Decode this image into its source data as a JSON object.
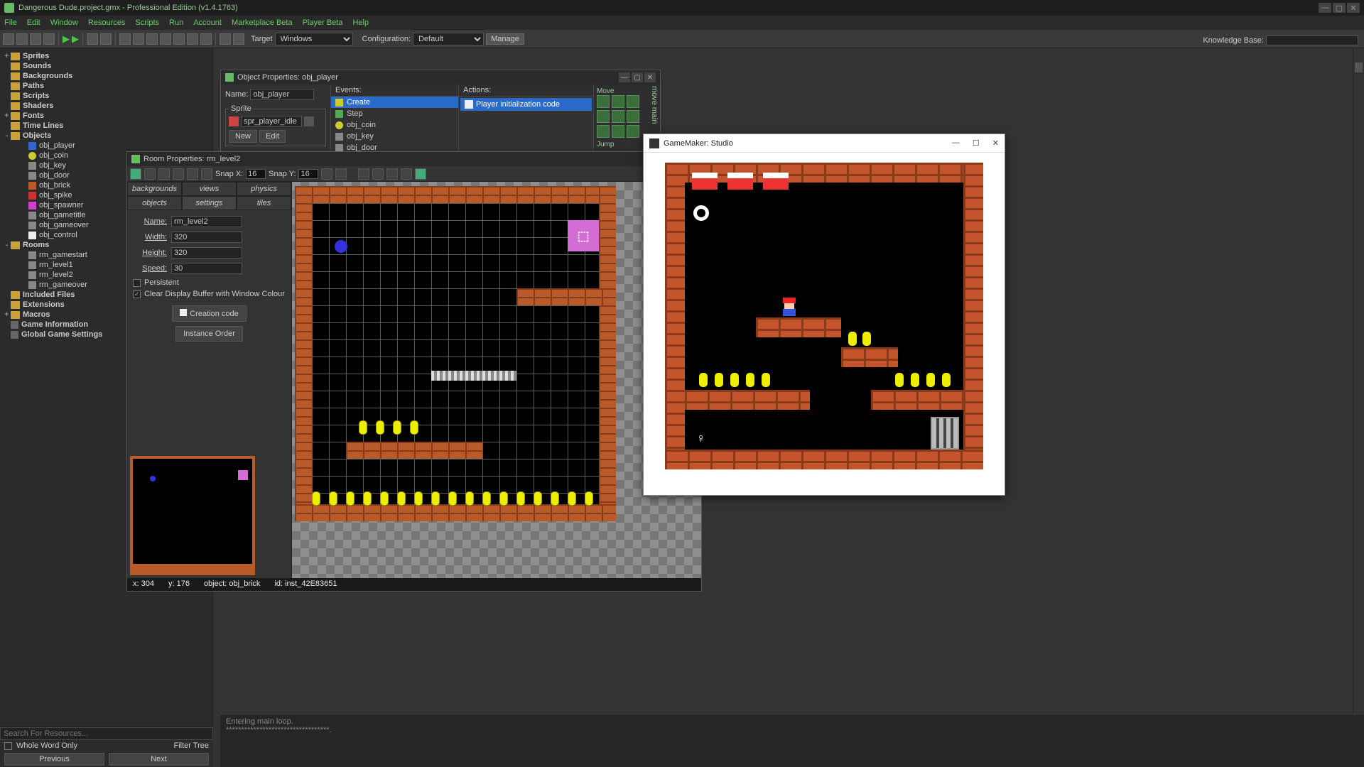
{
  "title": "Dangerous Dude.project.gmx  -  Professional Edition (v1.4.1763)",
  "menu": [
    "File",
    "Edit",
    "Window",
    "Resources",
    "Scripts",
    "Run",
    "Account",
    "Marketplace Beta",
    "Player Beta",
    "Help"
  ],
  "toolbar": {
    "target_label": "Target",
    "target_value": "Windows",
    "config_label": "Configuration:",
    "config_value": "Default",
    "manage": "Manage",
    "kb_label": "Knowledge Base:"
  },
  "tree": {
    "groups": [
      {
        "label": "Sprites",
        "exp": "+"
      },
      {
        "label": "Sounds"
      },
      {
        "label": "Backgrounds"
      },
      {
        "label": "Paths"
      },
      {
        "label": "Scripts"
      },
      {
        "label": "Shaders"
      },
      {
        "label": "Fonts",
        "exp": "+"
      },
      {
        "label": "Time Lines"
      },
      {
        "label": "Objects",
        "exp": "-",
        "children": [
          {
            "label": "obj_player",
            "cls": "icon-blue"
          },
          {
            "label": "obj_coin",
            "cls": "icon-yellow"
          },
          {
            "label": "obj_key",
            "cls": "icon-grey"
          },
          {
            "label": "obj_door",
            "cls": "icon-grey"
          },
          {
            "label": "obj_brick",
            "cls": "icon-orange"
          },
          {
            "label": "obj_spike",
            "cls": "icon-red"
          },
          {
            "label": "obj_spawner",
            "cls": "icon-pink"
          },
          {
            "label": "obj_gametitle",
            "cls": "icon-grey"
          },
          {
            "label": "obj_gameover",
            "cls": "icon-grey"
          },
          {
            "label": "obj_control",
            "cls": "icon-white"
          }
        ]
      },
      {
        "label": "Rooms",
        "exp": "-",
        "children": [
          {
            "label": "rm_gamestart",
            "cls": "icon-grey"
          },
          {
            "label": "rm_level1",
            "cls": "icon-grey"
          },
          {
            "label": "rm_level2",
            "cls": "icon-grey"
          },
          {
            "label": "rm_gameover",
            "cls": "icon-grey"
          }
        ]
      },
      {
        "label": "Included Files"
      },
      {
        "label": "Extensions"
      },
      {
        "label": "Macros",
        "exp": "+"
      },
      {
        "label": "Game Information",
        "leaf": true
      },
      {
        "label": "Global Game Settings",
        "leaf": true
      }
    ],
    "search_placeholder": "Search For Resources...",
    "whole_word": "Whole Word Only",
    "filter_tree": "Filter Tree",
    "prev": "Previous",
    "next": "Next"
  },
  "obj_win": {
    "title": "Object Properties: obj_player",
    "name_label": "Name:",
    "name_value": "obj_player",
    "sprite_legend": "Sprite",
    "sprite_value": "spr_player_idle",
    "new_btn": "New",
    "edit_btn": "Edit",
    "events_label": "Events:",
    "events": [
      "Create",
      "Step",
      "obj_coin",
      "obj_key",
      "obj_door"
    ],
    "actions_label": "Actions:",
    "action_text": "Player initialization code",
    "move_label": "Move",
    "jump_label": "Jump",
    "side_labels": [
      "move",
      "main"
    ]
  },
  "room_win": {
    "title": "Room Properties: rm_level2",
    "snapx_label": "Snap X:",
    "snapx": "16",
    "snapy_label": "Snap Y:",
    "snapy": "16",
    "tabs": [
      "backgrounds",
      "views",
      "physics",
      "objects",
      "settings",
      "tiles"
    ],
    "name_label": "Name:",
    "name": "rm_level2",
    "width_label": "Width:",
    "width": "320",
    "height_label": "Height:",
    "height": "320",
    "speed_label": "Speed:",
    "speed": "30",
    "persistent": "Persistent",
    "cleardisplay": "Clear Display Buffer with Window Colour",
    "creation_code": "Creation code",
    "instance_order": "Instance Order",
    "status": {
      "x": "x: 304",
      "y": "y: 176",
      "obj": "object: obj_brick",
      "id": "id: inst_42E83651"
    }
  },
  "run_win": {
    "title": "GameMaker: Studio"
  },
  "compile": {
    "line1": "Entering main loop.",
    "line2": "**********************************."
  }
}
